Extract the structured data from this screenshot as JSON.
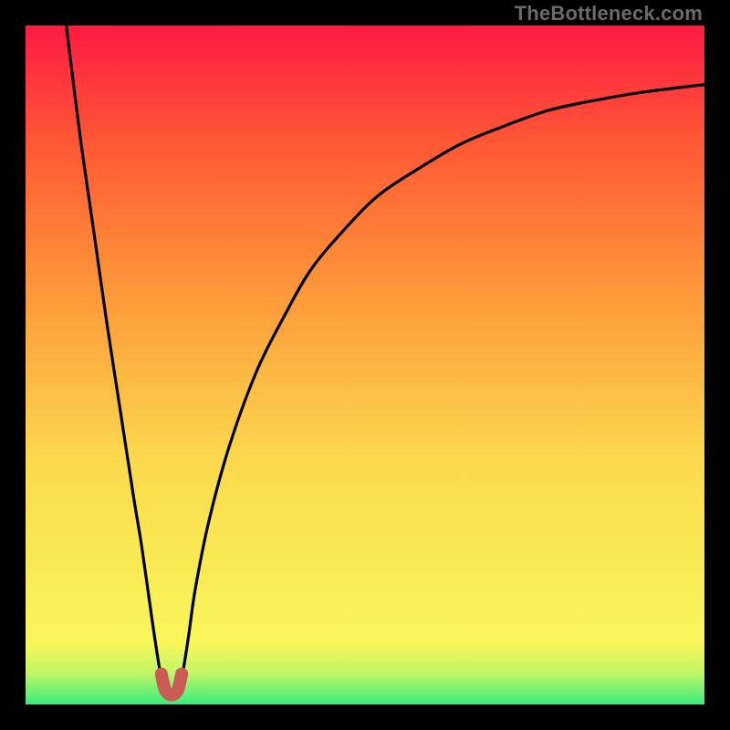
{
  "attribution": "TheBottleneck.com",
  "chart_data": {
    "type": "line",
    "title": "",
    "xlabel": "",
    "ylabel": "",
    "xlim": [
      0,
      100
    ],
    "ylim": [
      0,
      100
    ],
    "background_gradient": {
      "stops": [
        {
          "pos": 0.0,
          "color": "#37ed7d"
        },
        {
          "pos": 0.045,
          "color": "#bef566"
        },
        {
          "pos": 0.09,
          "color": "#f8f65a"
        },
        {
          "pos": 0.36,
          "color": "#fbd94c"
        },
        {
          "pos": 0.6,
          "color": "#fd9a3a"
        },
        {
          "pos": 0.82,
          "color": "#ff5a35"
        },
        {
          "pos": 1.0,
          "color": "#ff1a44"
        }
      ]
    },
    "series": [
      {
        "name": "bottleneck-curve",
        "description": "bottleneck % vs component capability; minimum near x≈21",
        "x": [
          6,
          8,
          10,
          12,
          14,
          16,
          17,
          18,
          19,
          20,
          21,
          22,
          23,
          24,
          25,
          27,
          30,
          34,
          38,
          42,
          47,
          52,
          58,
          64,
          70,
          77,
          84,
          91,
          100
        ],
        "y": [
          100,
          84,
          70,
          56,
          43,
          30,
          24,
          17,
          10,
          4,
          2,
          2,
          4,
          10,
          17,
          27,
          38,
          49,
          57,
          64,
          70,
          75,
          79,
          82.5,
          85,
          87.5,
          89,
          90.2,
          91.3
        ]
      },
      {
        "name": "optimal-marker",
        "description": "red U-shaped marker at the bottleneck minimum",
        "type": "marker",
        "x": [
          20,
          20.5,
          21,
          21.5,
          22,
          22.5,
          23
        ],
        "y": [
          4.5,
          2.3,
          1.6,
          1.4,
          1.6,
          2.3,
          4.5
        ],
        "stroke": "#c95a54",
        "stroke_width": 14
      }
    ]
  }
}
